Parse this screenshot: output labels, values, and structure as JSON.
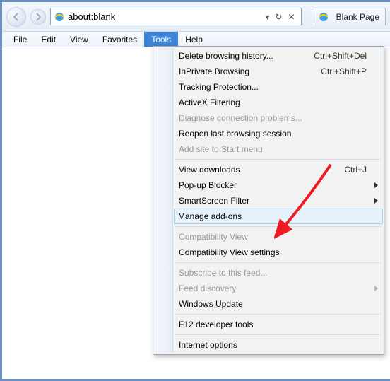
{
  "nav": {
    "address": "about:blank",
    "dropdown_glyph": "▾",
    "refresh_glyph": "↻",
    "stop_glyph": "✕"
  },
  "tab": {
    "title": "Blank Page"
  },
  "menubar": {
    "file": "File",
    "edit": "Edit",
    "view": "View",
    "favorites": "Favorites",
    "tools": "Tools",
    "help": "Help"
  },
  "menu": {
    "delete_history": "Delete browsing history...",
    "delete_history_sc": "Ctrl+Shift+Del",
    "inprivate": "InPrivate Browsing",
    "inprivate_sc": "Ctrl+Shift+P",
    "tracking": "Tracking Protection...",
    "activex": "ActiveX Filtering",
    "diagnose": "Diagnose connection problems...",
    "reopen": "Reopen last browsing session",
    "addsite": "Add site to Start menu",
    "downloads": "View downloads",
    "downloads_sc": "Ctrl+J",
    "popup": "Pop-up Blocker",
    "smartscreen": "SmartScreen Filter",
    "addons": "Manage add-ons",
    "compat": "Compatibility View",
    "compat_settings": "Compatibility View settings",
    "subscribe": "Subscribe to this feed...",
    "feed": "Feed discovery",
    "winupdate": "Windows Update",
    "f12": "F12 developer tools",
    "inetopt": "Internet options"
  }
}
